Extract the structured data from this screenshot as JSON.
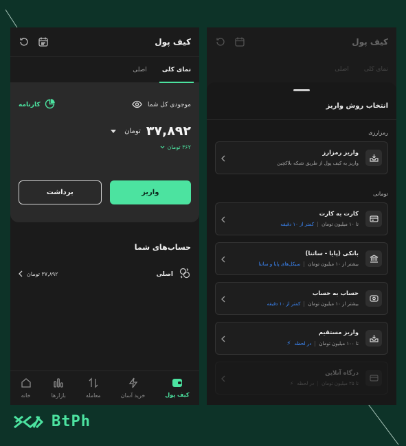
{
  "colors": {
    "accent": "#4ce3a0",
    "link": "#3d8bff",
    "bg": "#0d3328"
  },
  "left": {
    "header": {
      "title": "کیف پول"
    },
    "tabs": [
      {
        "label": "نمای کلی",
        "active": true
      },
      {
        "label": "اصلی",
        "active": false
      }
    ],
    "balance": {
      "label": "موجودی کل شما",
      "report": "کارنامه",
      "amount": "۳۷,۸۹۲",
      "unit": "تومان",
      "sub_amount": "۳۶۲ تومان"
    },
    "buttons": {
      "deposit": "واریز",
      "withdraw": "برداشت"
    },
    "accounts": {
      "title": "حساب‌های شما",
      "rows": [
        {
          "name": "اصلی",
          "value": "۳۷,۸۹۲ تومان"
        }
      ]
    },
    "nav": [
      {
        "label": "کیف پول",
        "icon": "wallet-icon",
        "active": true
      },
      {
        "label": "خرید آسان",
        "icon": "flash-icon",
        "active": false
      },
      {
        "label": "معامله",
        "icon": "swap-icon",
        "active": false
      },
      {
        "label": "بازارها",
        "icon": "chart-icon",
        "active": false
      },
      {
        "label": "خانه",
        "icon": "home-icon",
        "active": false
      }
    ]
  },
  "right": {
    "header": {
      "title": "کیف پول"
    },
    "tabs": [
      {
        "label": "نمای کلی"
      },
      {
        "label": "اصلی"
      }
    ],
    "sheet": {
      "title": "انتخاب روش واریز",
      "crypto_label": "رمزارزی",
      "crypto_option": {
        "title": "واریز رمزارز",
        "desc": "واریز به کیف پول از طریق شبکه بلاکچین"
      },
      "toman_label": "تومانی",
      "options": [
        {
          "title": "کارت به کارت",
          "limit": "تا ۱۰ میلیون تومان",
          "tag": "کمتر از ۱۰ دقیقه"
        },
        {
          "title": "بانکی (پایا - ساتنا)",
          "limit": "بیشتر از ۱۰ میلیون تومان",
          "tag": "سیکل‌های پایا و ساتنا"
        },
        {
          "title": "حساب به حساب",
          "limit": "بیشتر از ۱۰ میلیون تومان",
          "tag": "کمتر از ۱۰ دقیقه"
        },
        {
          "title": "واریز مستقیم",
          "limit": "تا ۱۰۰ میلیون تومان",
          "tag": "در لحظه"
        },
        {
          "title": "درگاه آنلاین",
          "limit": "تا ۲۵ میلیون تومان",
          "tag": "در لحظه"
        }
      ]
    }
  },
  "brand": {
    "logo": "BtPh"
  }
}
